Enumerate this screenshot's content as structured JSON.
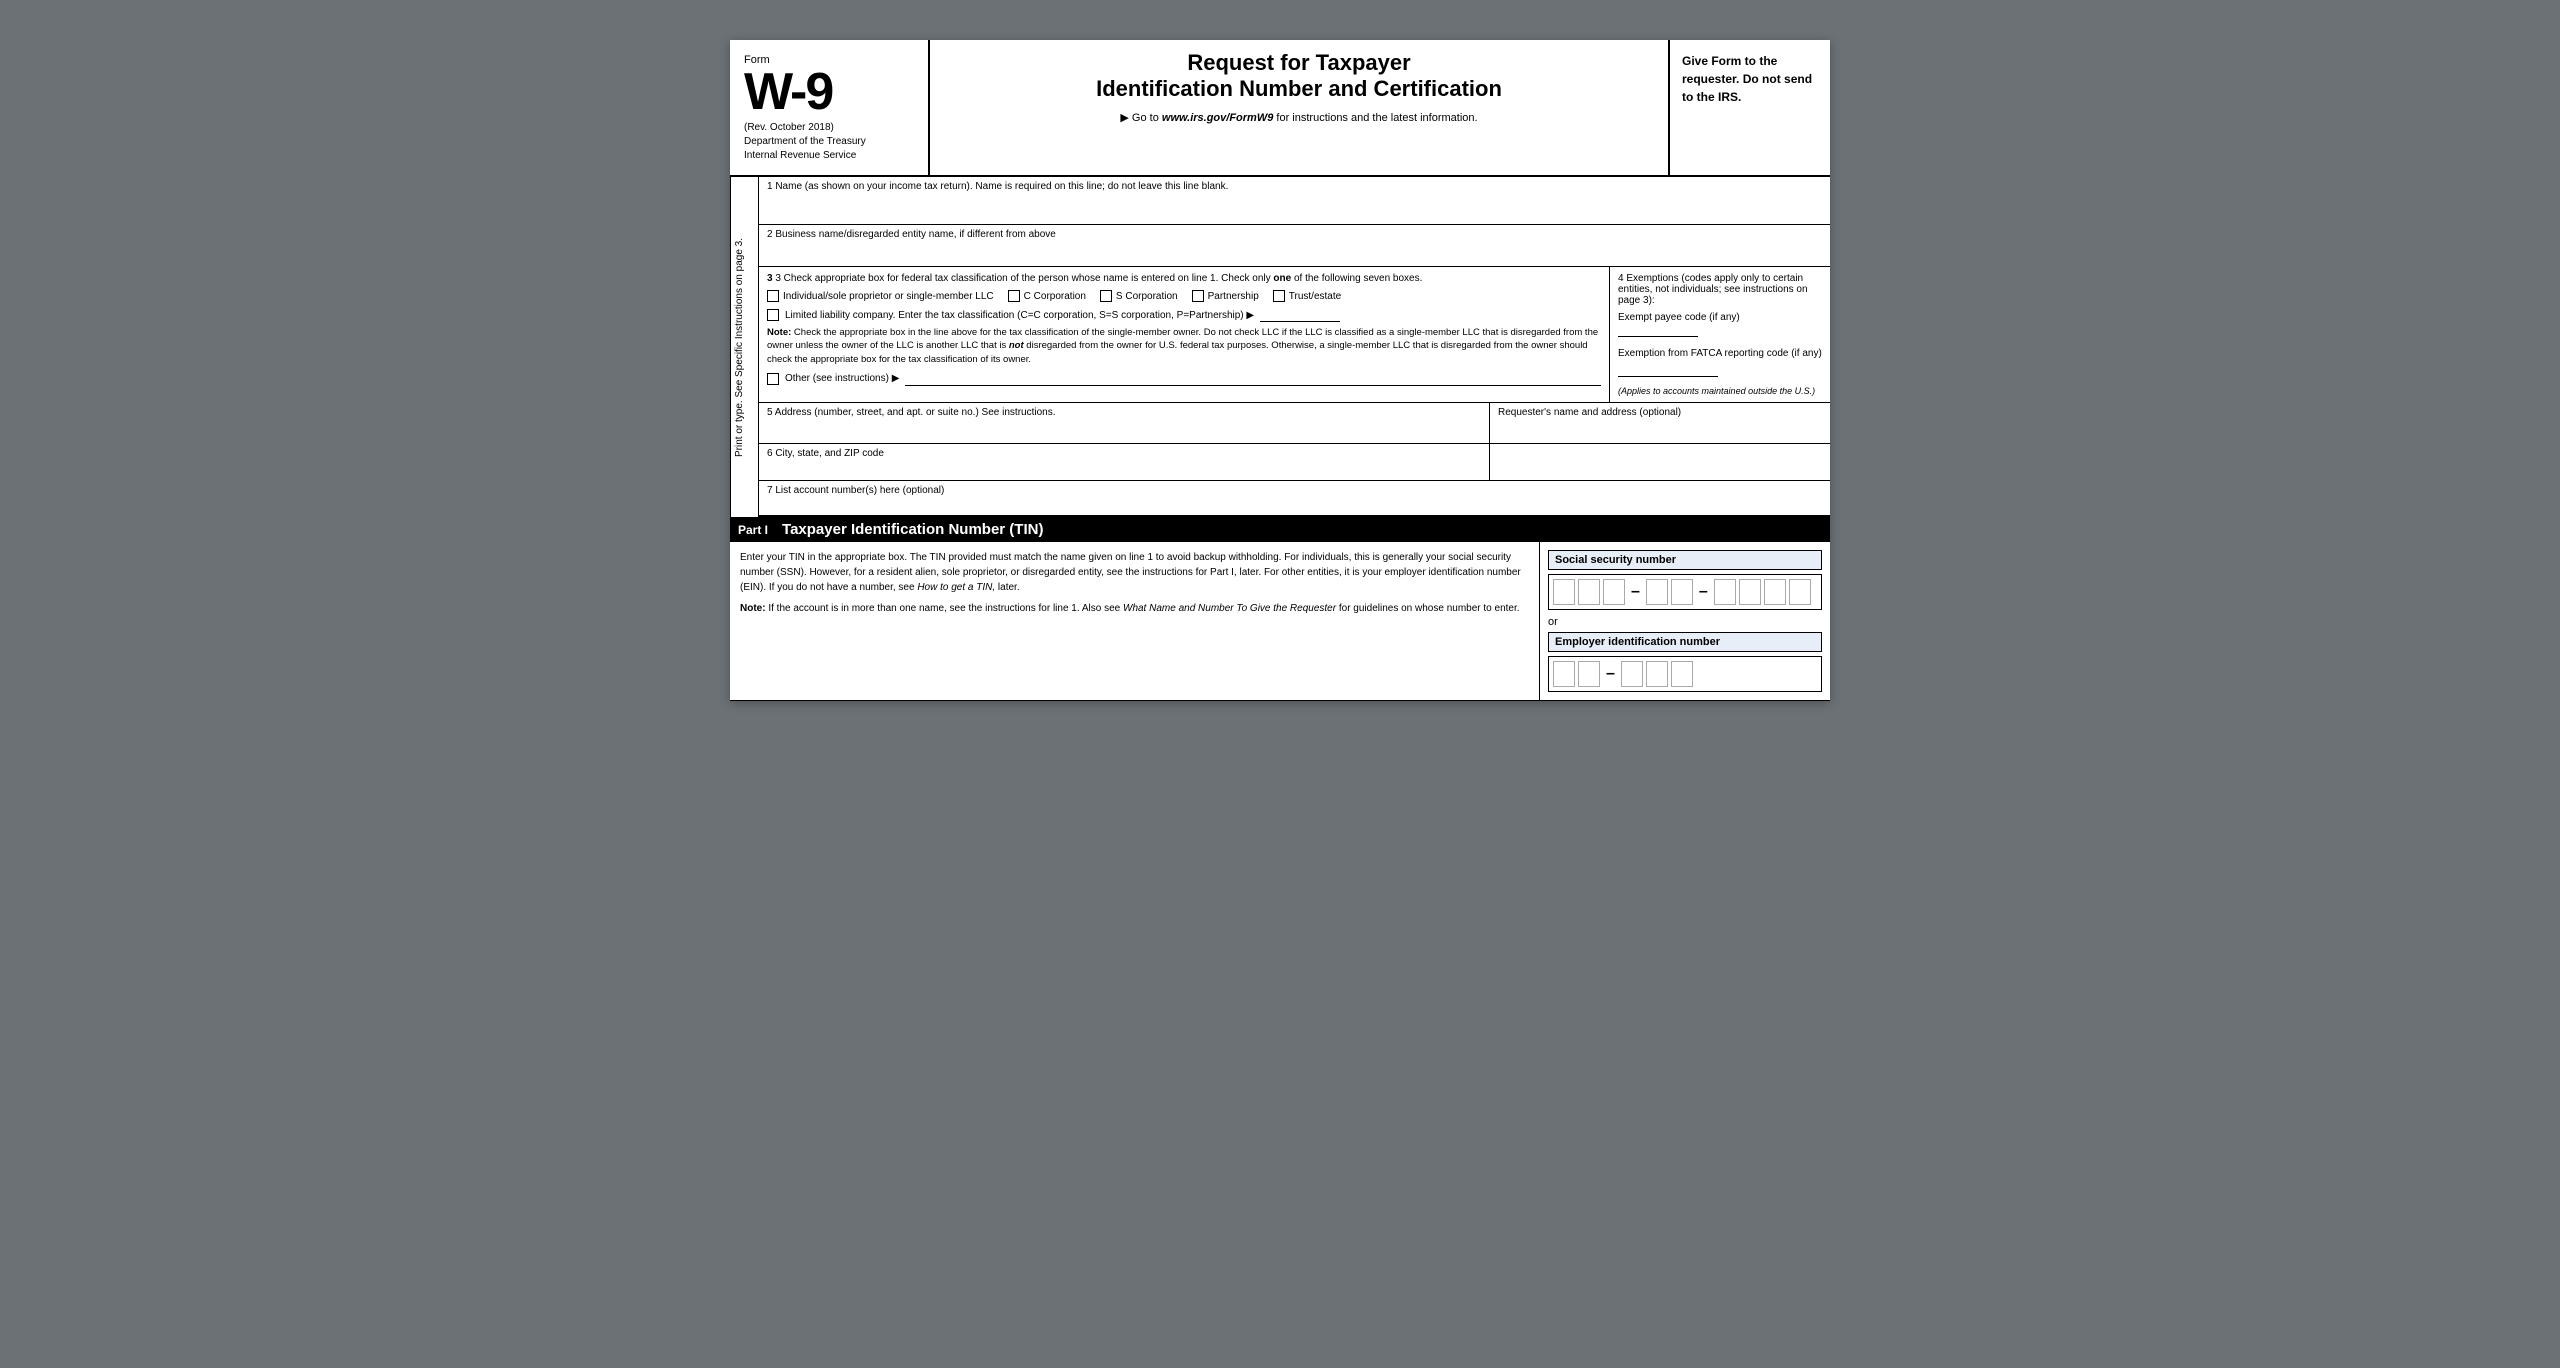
{
  "form": {
    "number": "W-9",
    "form_label": "Form",
    "rev": "(Rev. October 2018)",
    "dept1": "Department of the Treasury",
    "dept2": "Internal Revenue Service",
    "title_line1": "Request for Taxpayer",
    "title_line2": "Identification Number and Certification",
    "goto": "▶ Go to",
    "goto_url": "www.irs.gov/FormW9",
    "goto_suffix": "for instructions and the latest information.",
    "header_right": "Give Form to the requester. Do not send to the IRS."
  },
  "sidebar": {
    "text": "Print or type.    See Specific Instructions on page 3."
  },
  "fields": {
    "field1_label": "1  Name (as shown on your income tax return). Name is required on this line; do not leave this line blank.",
    "field2_label": "2  Business name/disregarded entity name, if different from above",
    "field3_label": "3  Check appropriate box for federal tax classification of the person whose name is entered on line 1. Check only",
    "field3_one": "one",
    "field3_of": "of the following seven boxes.",
    "checkbox_individual": "Individual/sole proprietor or single-member LLC",
    "checkbox_c_corp": "C Corporation",
    "checkbox_s_corp": "S Corporation",
    "checkbox_partnership": "Partnership",
    "checkbox_trust": "Trust/estate",
    "llc_label": "Limited liability company. Enter the tax classification (C=C corporation, S=S corporation, P=Partnership) ▶",
    "note_label": "Note:",
    "note_text": "Check the appropriate box in the line above for the tax classification of the single-member owner.  Do not check LLC if the LLC is classified as a single-member LLC that is disregarded from the owner unless the owner of the LLC is another LLC that is",
    "note_not": "not",
    "note_text2": "disregarded from the owner for U.S. federal tax purposes. Otherwise, a single-member LLC that is disregarded from the owner should check the appropriate box for the tax classification of its owner.",
    "other_label": "Other (see instructions) ▶",
    "exemptions_header": "4  Exemptions (codes apply only to certain entities, not individuals; see instructions on page 3):",
    "exempt_payee_label": "Exempt payee code (if any)",
    "fatca_label": "Exemption from FATCA reporting code (if any)",
    "applies_note": "(Applies to accounts maintained outside the U.S.)",
    "field5_label": "5  Address (number, street, and apt. or suite no.) See instructions.",
    "requester_label": "Requester's name and address (optional)",
    "field6_label": "6  City, state, and ZIP code",
    "field7_label": "7  List account number(s) here (optional)"
  },
  "part1": {
    "label": "Part I",
    "title": "Taxpayer Identification Number (TIN)",
    "body_text": "Enter your TIN in the appropriate box. The TIN provided must match the name given on line 1 to avoid backup withholding. For individuals, this is generally your social security number (SSN). However, for a resident alien, sole proprietor, or disregarded entity, see the instructions for Part I, later. For other entities, it is your employer identification number (EIN). If you do not have a number, see",
    "how_to_get": "How to get a TIN,",
    "body_text2": "later.",
    "note_label": "Note:",
    "note_body": "If the account is in more than one name, see the instructions for line 1. Also see",
    "what_name": "What Name and Number To Give the Requester",
    "note_end": "for guidelines on whose number to enter.",
    "ssn_label": "Social security number",
    "or_text": "or",
    "ein_label": "Employer identification number"
  }
}
